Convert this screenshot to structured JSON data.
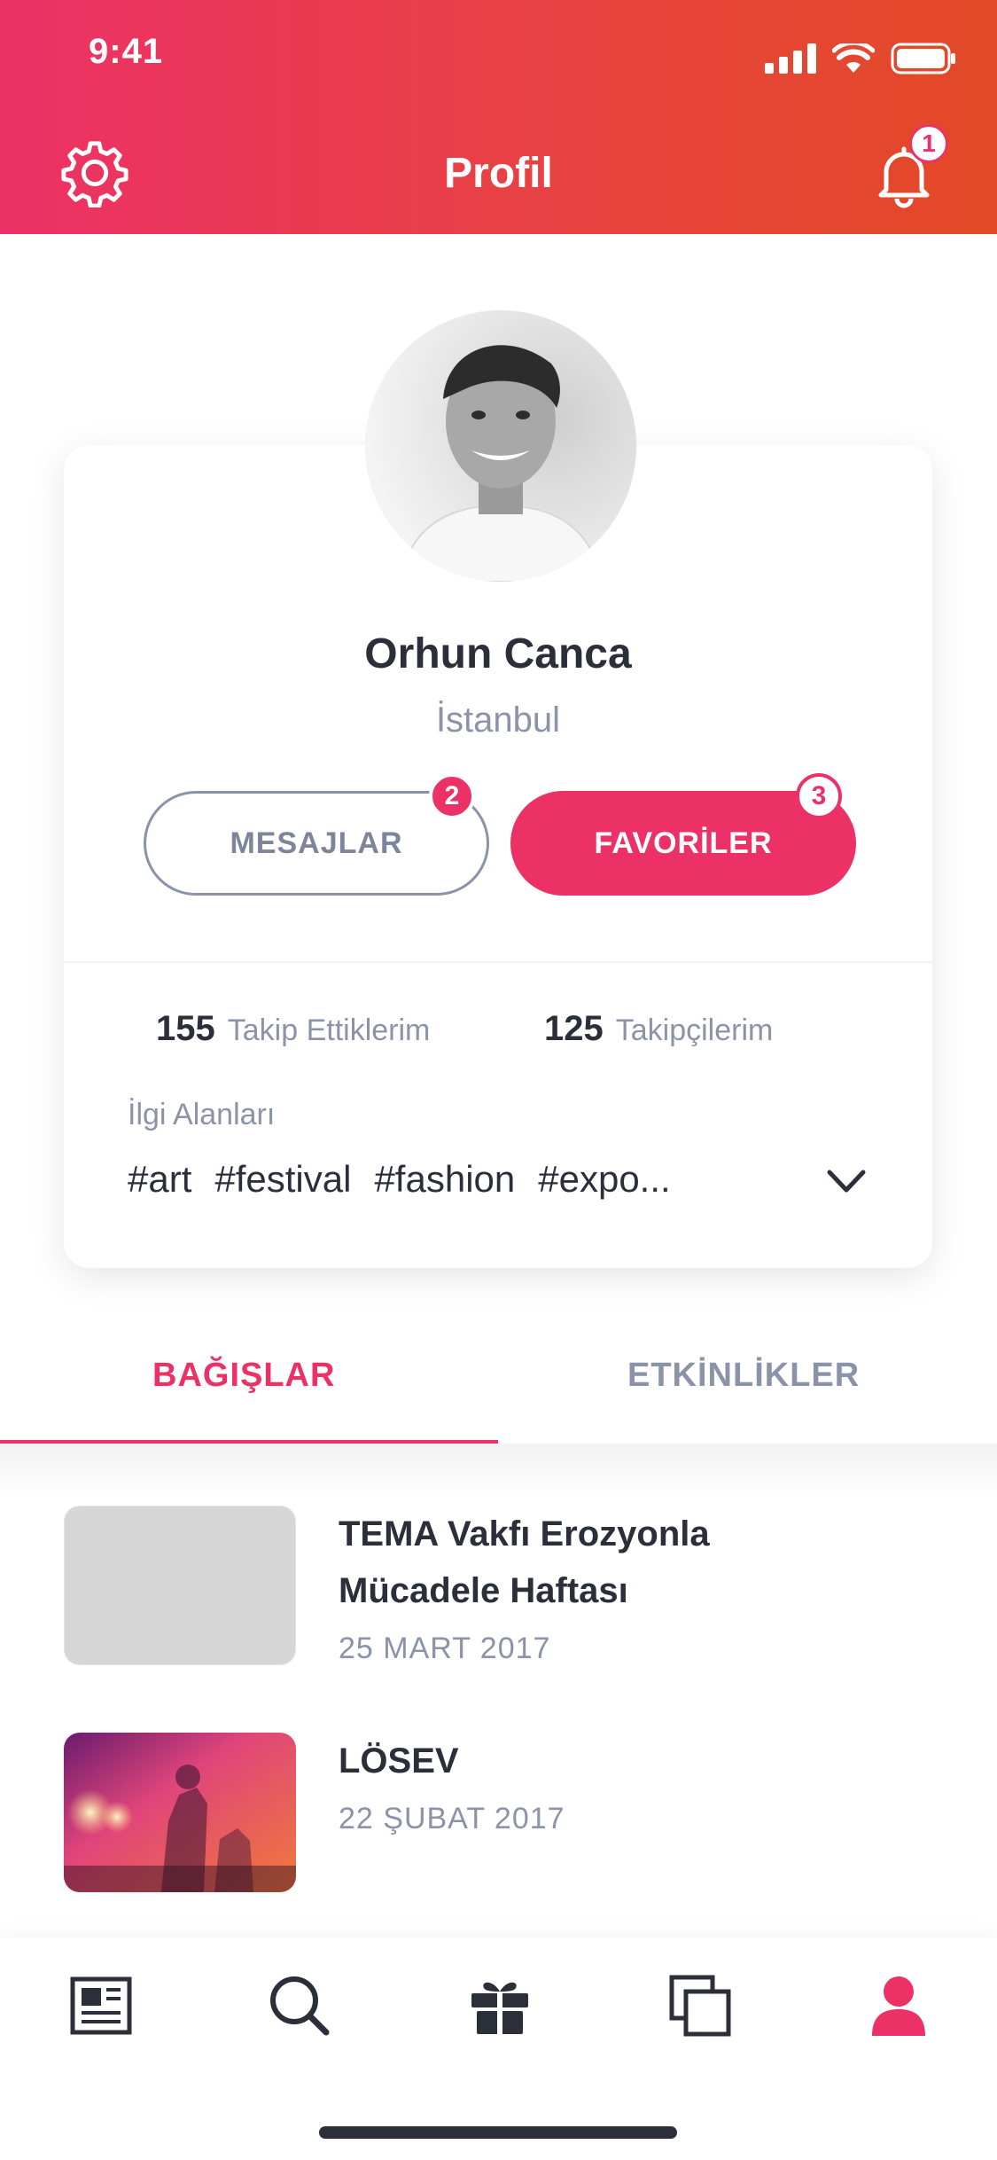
{
  "status_bar": {
    "time": "9:41"
  },
  "header": {
    "title": "Profil",
    "notification_count": "1"
  },
  "profile": {
    "name": "Orhun Canca",
    "city": "İstanbul",
    "messages_label": "MESAJLAR",
    "messages_badge": "2",
    "favorites_label": "FAVORİLER",
    "favorites_badge": "3",
    "following_count": "155",
    "following_label": "Takip Ettiklerim",
    "followers_count": "125",
    "followers_label": "Takipçilerim",
    "interests_title": "İlgi Alanları",
    "tags": [
      "#art",
      "#festival",
      "#fashion",
      "#expo..."
    ]
  },
  "tabs": {
    "donations": "BAĞIŞLAR",
    "events": "ETKİNLİKLER"
  },
  "list": [
    {
      "title": "TEMA Vakfı Erozyonla Mücadele Haftası",
      "date": "25 MART 2017"
    },
    {
      "title": "LÖSEV",
      "date": "22 ŞUBAT 2017"
    }
  ],
  "bottom_nav": {
    "icons": [
      "news-icon",
      "search-icon",
      "gift-icon",
      "collections-icon",
      "profile-icon"
    ],
    "active": "profile-icon"
  },
  "colors": {
    "accent": "#ec3166",
    "muted": "#8a93a8",
    "text": "#2b2f3a"
  }
}
